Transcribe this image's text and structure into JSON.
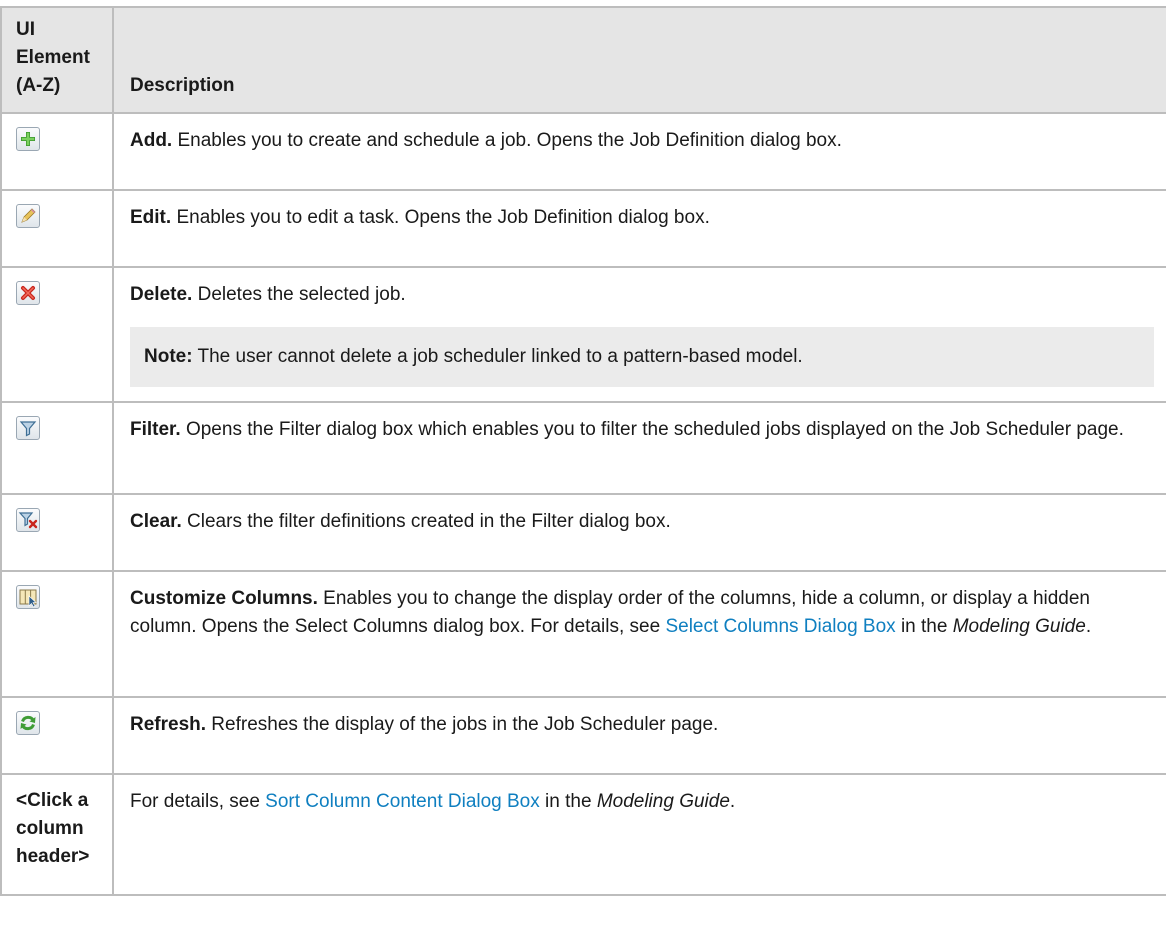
{
  "header": {
    "col1": "UI Element (A-Z)",
    "col1_lines": [
      "UI",
      "Element",
      "(A-Z)"
    ],
    "col2": "Description"
  },
  "rows": [
    {
      "icon": "add-icon",
      "term": "Add.",
      "text": " Enables you to create and schedule a job. Opens the Job Definition dialog box."
    },
    {
      "icon": "edit-icon",
      "term": "Edit.",
      "text": " Enables you to edit a task. Opens the Job Definition dialog box."
    },
    {
      "icon": "delete-icon",
      "term": "Delete.",
      "text": " Deletes the selected job.",
      "note_label": "Note:",
      "note_text": " The user cannot delete a job scheduler linked to a pattern-based model."
    },
    {
      "icon": "filter-icon",
      "term": "Filter.",
      "text": " Opens the Filter dialog box which enables you to filter the scheduled jobs displayed on the Job Scheduler page."
    },
    {
      "icon": "clear-filter-icon",
      "term": "Clear.",
      "text": " Clears the filter definitions created in the Filter dialog box."
    },
    {
      "icon": "customize-columns-icon",
      "term": "Customize Columns.",
      "text": " Enables you to change the display order of the columns, hide a column, or display a hidden column. Opens the Select Columns dialog box. For details, see ",
      "link": "Select Columns Dialog Box",
      "text_after": " in the ",
      "guide": "Modeling Guide",
      "end": "."
    },
    {
      "icon": "refresh-icon",
      "term": "Refresh.",
      "text": " Refreshes the display of the jobs in the Job Scheduler page."
    },
    {
      "element_label_lines": [
        "<Click a",
        "column",
        "header>"
      ],
      "text": "For details, see ",
      "link": "Sort Column Content Dialog Box",
      "text_after": " in the ",
      "guide": "Modeling Guide",
      "end": "."
    }
  ],
  "colors": {
    "header_bg": "#e5e5e5",
    "border": "#bdbdbd",
    "link": "#0f7fc0",
    "note_bg": "#ebebeb"
  }
}
